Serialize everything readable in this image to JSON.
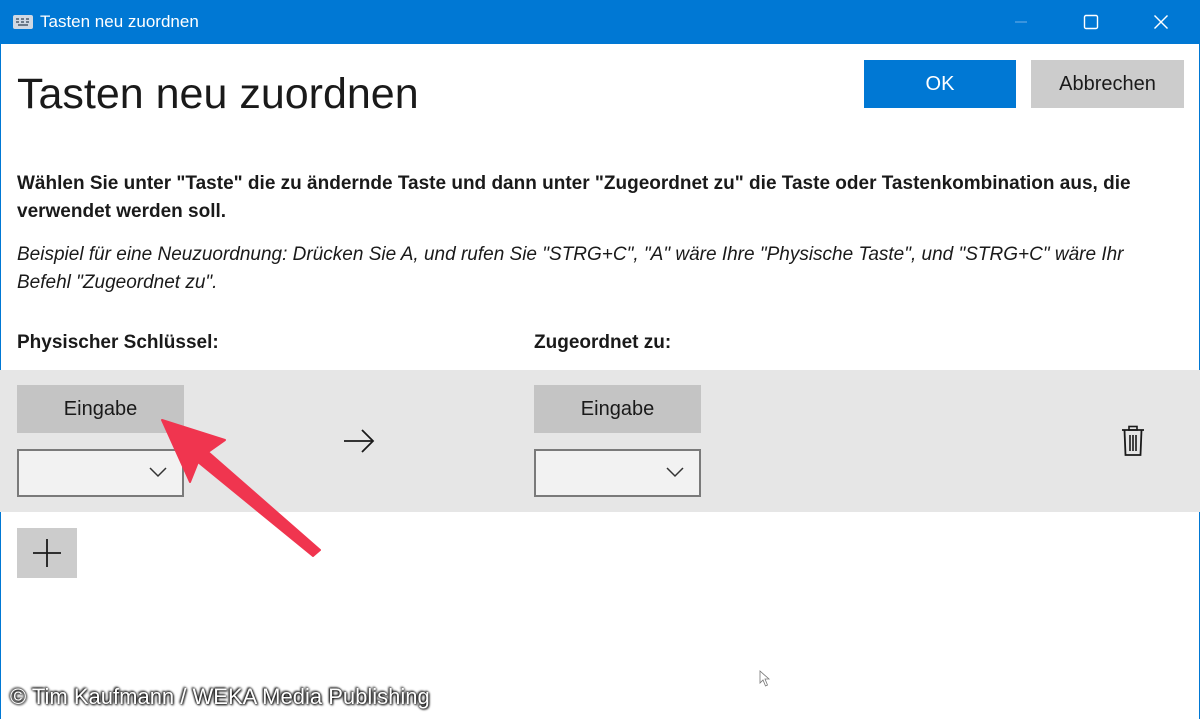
{
  "window": {
    "title": "Tasten neu zuordnen",
    "accent_color": "#0078d4",
    "controls": [
      "minimize-icon",
      "maximize-icon",
      "close-icon"
    ]
  },
  "header": {
    "title": "Tasten neu zuordnen",
    "ok_label": "OK",
    "cancel_label": "Abbrechen"
  },
  "instructions": {
    "text": "Wählen Sie unter \"Taste\" die zu ändernde Taste und dann unter \"Zugeordnet zu\" die Taste oder Tastenkombination aus, die verwendet werden soll.",
    "example_line1": "Beispiel für eine Neuzuordnung: Drücken Sie A, und rufen Sie \"STRG+C\", \"A\" wäre Ihre \"Physische Taste\", und \"STRG+C\" wäre Ihr",
    "example_line2": "Befehl \"Zugeordnet zu\"."
  },
  "columns": {
    "physical_label": "Physischer Schlüssel:",
    "mapped_label": "Zugeordnet zu:"
  },
  "mapping": {
    "physical_key": "Eingabe",
    "physical_combo_value": "",
    "mapped_key": "Eingabe",
    "mapped_combo_value": "",
    "arrow_icon": "arrow-right-icon",
    "delete_icon": "trash-icon"
  },
  "add_icon": "plus-icon",
  "annotation": {
    "color": "#f0354f"
  },
  "copyright": "© Tim Kaufmann / WEKA Media Publishing"
}
